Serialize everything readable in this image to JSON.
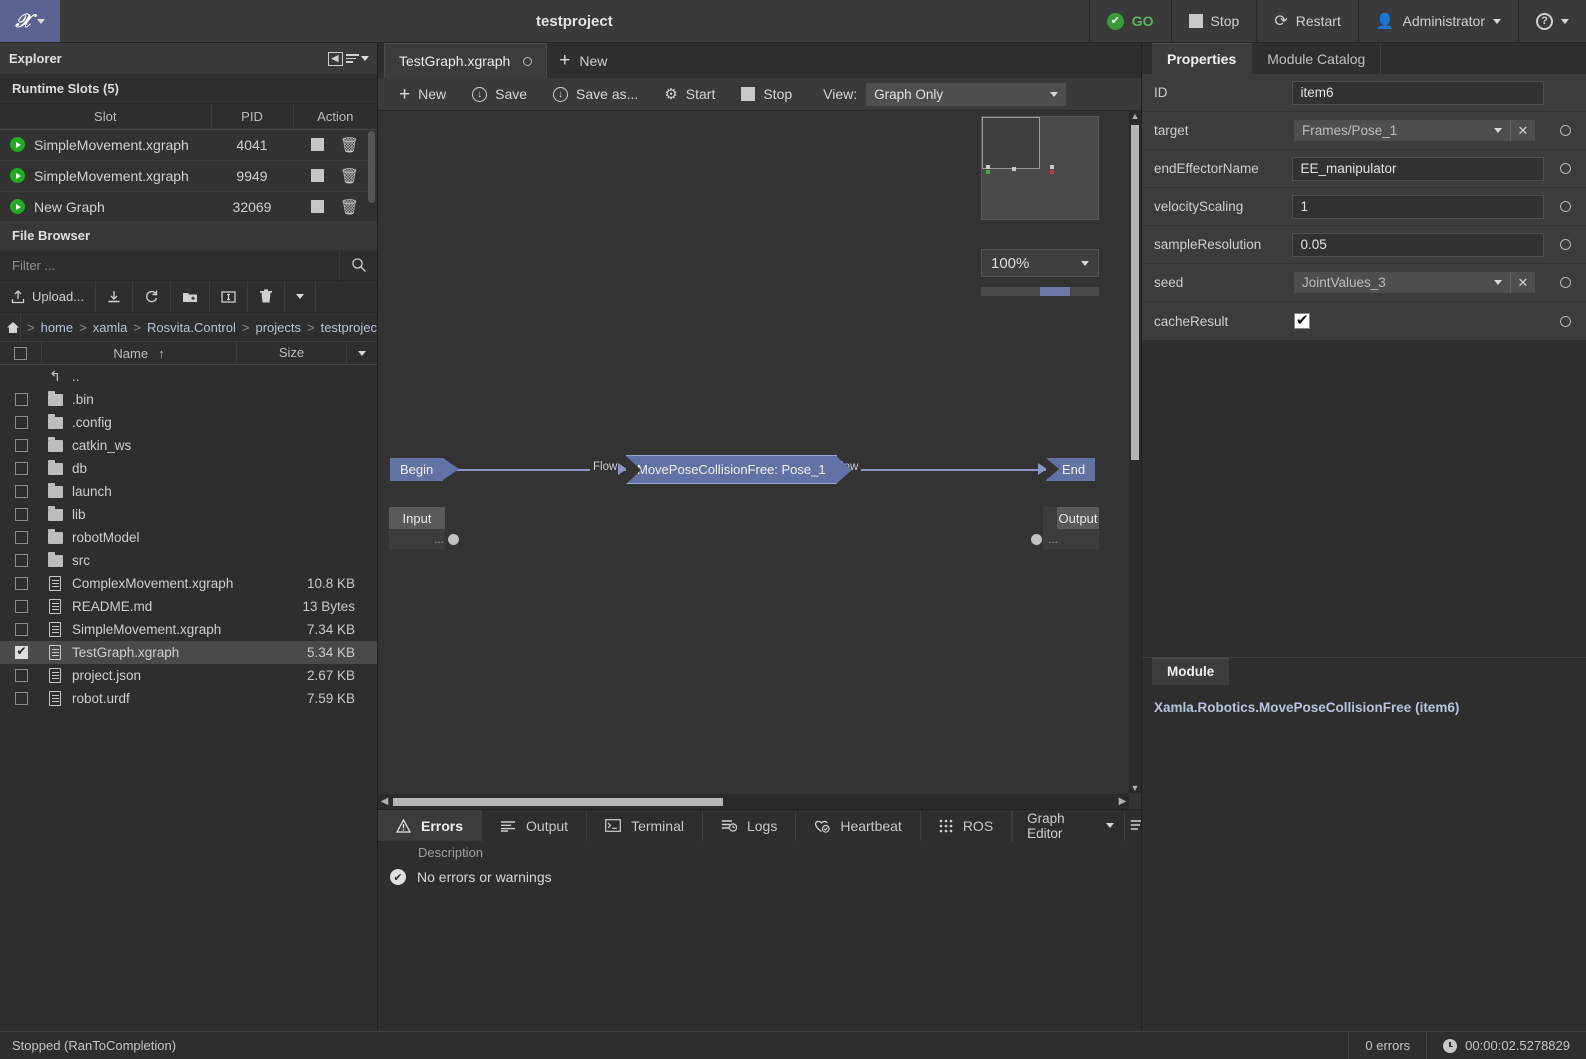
{
  "titlebar": {
    "logo": "xamla-logo-icon",
    "project_title": "testproject",
    "buttons": [
      {
        "id": "go",
        "label": "GO"
      },
      {
        "id": "stop",
        "label": "Stop"
      },
      {
        "id": "restart",
        "label": "Restart"
      },
      {
        "id": "user",
        "label": "Administrator"
      }
    ],
    "go_color": "#3a9b3a"
  },
  "explorer": {
    "header": "Explorer",
    "runtime_slots_title": "Runtime Slots (5)",
    "columns": [
      "Slot",
      "PID",
      "Action"
    ],
    "slots": [
      {
        "name": "SimpleMovement.xgraph",
        "pid": "4041"
      },
      {
        "name": "SimpleMovement.xgraph",
        "pid": "9949"
      },
      {
        "name": "New Graph",
        "pid": "32069"
      }
    ],
    "file_browser_title": "File Browser",
    "filter_placeholder": "Filter ...",
    "filter_value": "",
    "toolbar": [
      {
        "id": "upload",
        "label": "Upload...",
        "icon": "upload-icon"
      },
      {
        "id": "download",
        "label": "",
        "icon": "download-icon"
      },
      {
        "id": "refresh",
        "label": "",
        "icon": "refresh-icon"
      },
      {
        "id": "new-folder",
        "label": "",
        "icon": "new-folder-icon"
      },
      {
        "id": "rename",
        "label": "",
        "icon": "rename-icon"
      },
      {
        "id": "delete",
        "label": "",
        "icon": "trash-icon"
      },
      {
        "id": "more",
        "label": "",
        "icon": "chevron-down-icon"
      }
    ],
    "breadcrumbs": [
      "home",
      "xamla",
      "Rosvita.Control",
      "projects",
      "testproject"
    ],
    "file_columns": {
      "name": "Name",
      "size": "Size",
      "sort": "ascending"
    },
    "files": [
      {
        "name": "..",
        "size": "",
        "type": "up",
        "checked": false
      },
      {
        "name": ".bin",
        "size": "",
        "type": "folder",
        "checked": false
      },
      {
        "name": ".config",
        "size": "",
        "type": "folder",
        "checked": false
      },
      {
        "name": "catkin_ws",
        "size": "",
        "type": "folder",
        "checked": false
      },
      {
        "name": "db",
        "size": "",
        "type": "folder",
        "checked": false
      },
      {
        "name": "launch",
        "size": "",
        "type": "folder",
        "checked": false
      },
      {
        "name": "lib",
        "size": "",
        "type": "folder",
        "checked": false
      },
      {
        "name": "robotModel",
        "size": "",
        "type": "folder",
        "checked": false
      },
      {
        "name": "src",
        "size": "",
        "type": "folder",
        "checked": false
      },
      {
        "name": "ComplexMovement.xgraph",
        "size": "10.8 KB",
        "type": "file",
        "checked": false
      },
      {
        "name": "README.md",
        "size": "13 Bytes",
        "type": "file",
        "checked": false
      },
      {
        "name": "SimpleMovement.xgraph",
        "size": "7.34 KB",
        "type": "file",
        "checked": false
      },
      {
        "name": "TestGraph.xgraph",
        "size": "5.34 KB",
        "type": "file",
        "checked": true
      },
      {
        "name": "project.json",
        "size": "2.67 KB",
        "type": "file",
        "checked": false
      },
      {
        "name": "robot.urdf",
        "size": "7.59 KB",
        "type": "file",
        "checked": false
      }
    ]
  },
  "editor": {
    "tabs": [
      {
        "label": "TestGraph.xgraph",
        "active": true
      }
    ],
    "new_tab_label": "New",
    "toolbar": [
      {
        "id": "new",
        "label": "New",
        "icon": "plus-icon"
      },
      {
        "id": "save",
        "label": "Save",
        "icon": "save-icon"
      },
      {
        "id": "save-as",
        "label": "Save as...",
        "icon": "save-as-icon"
      },
      {
        "id": "start",
        "label": "Start",
        "icon": "gear-play-icon"
      },
      {
        "id": "stop",
        "label": "Stop",
        "icon": "stop-square-icon"
      }
    ],
    "view_label": "View:",
    "view_value": "Graph Only",
    "zoom_value": "100%",
    "graph": {
      "nodes": [
        {
          "id": "begin",
          "label": "Begin",
          "color": "#6272a4"
        },
        {
          "id": "main",
          "label": "MovePoseCollisionFree: Pose_1",
          "color": "#6272a4"
        },
        {
          "id": "end",
          "label": "End",
          "color": "#6272a4"
        },
        {
          "id": "input",
          "label": "Input",
          "sub": "..."
        },
        {
          "id": "output",
          "label": "Output",
          "sub": "..."
        }
      ],
      "edges": [
        {
          "from": "begin",
          "to": "main",
          "label": "Flow"
        },
        {
          "from": "main",
          "to": "end",
          "label": "Flow"
        }
      ]
    }
  },
  "bottom_panel": {
    "tabs": [
      {
        "id": "errors",
        "label": "Errors",
        "icon": "warning-triangle-icon",
        "active": true
      },
      {
        "id": "output",
        "label": "Output",
        "icon": "lines-icon",
        "active": false
      },
      {
        "id": "terminal",
        "label": "Terminal",
        "icon": "terminal-icon",
        "active": false
      },
      {
        "id": "logs",
        "label": "Logs",
        "icon": "logs-clock-icon",
        "active": false
      },
      {
        "id": "heartbeat",
        "label": "Heartbeat",
        "icon": "heartbeat-icon",
        "active": false
      },
      {
        "id": "ros",
        "label": "ROS",
        "icon": "ros-dots-icon",
        "active": false
      }
    ],
    "editor_selector": "Graph Editor",
    "description_header": "Description",
    "message": "No errors or warnings"
  },
  "right_panel": {
    "tabs": [
      {
        "id": "properties",
        "label": "Properties",
        "active": true
      },
      {
        "id": "module-catalog",
        "label": "Module Catalog",
        "active": false
      }
    ],
    "properties": [
      {
        "name": "ID",
        "type": "text",
        "value": "item6",
        "ring": false
      },
      {
        "name": "target",
        "type": "combo",
        "value": "Frames/Pose_1",
        "ring": true
      },
      {
        "name": "endEffectorName",
        "type": "text",
        "value": "EE_manipulator",
        "ring": true
      },
      {
        "name": "velocityScaling",
        "type": "text",
        "value": "1",
        "ring": true
      },
      {
        "name": "sampleResolution",
        "type": "text",
        "value": "0.05",
        "ring": true
      },
      {
        "name": "seed",
        "type": "combo",
        "value": "JointValues_3",
        "ring": true
      },
      {
        "name": "cacheResult",
        "type": "checkbox",
        "value": "checked",
        "ring": true
      }
    ],
    "module_tab_label": "Module",
    "module_name": "Xamla.Robotics.MovePoseCollisionFree (item6)"
  },
  "status_bar": {
    "state": "Stopped (RanToCompletion)",
    "errors": "0 errors",
    "elapsed": "00:00:02.5278829"
  }
}
